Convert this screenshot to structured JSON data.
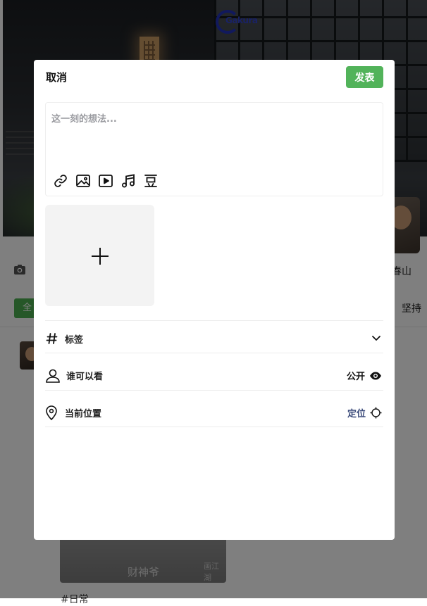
{
  "background": {
    "logo": {
      "name": "logo-icon",
      "text": "Gakura"
    },
    "profile_name": "春山",
    "tabs": {
      "first": "全",
      "last": "坚持"
    },
    "post": {
      "image_caption": "财神爷",
      "image_watermark": "画江湖",
      "tag": "#日常"
    },
    "overlay_color": "rgba(0,0,0,0.5)"
  },
  "modal": {
    "cancel_label": "取消",
    "publish_label": "发表",
    "publish_color": "#52b35a",
    "editor": {
      "placeholder": "这一刻的想法...",
      "value": "",
      "toolbar": [
        "link-icon",
        "image-icon",
        "video-icon",
        "music-icon",
        "douban-icon"
      ]
    },
    "upload": {
      "icon": "plus-icon"
    },
    "tags_row": {
      "icon": "hash-icon",
      "label": "标签",
      "action_icon": "chevron-down-icon"
    },
    "visibility_row": {
      "icon": "user-icon",
      "label": "谁可以看",
      "value": "公开",
      "value_icon": "eye-icon"
    },
    "location_row": {
      "icon": "location-pin-icon",
      "label": "当前位置",
      "value": "定位",
      "value_color": "#3a4a7a",
      "value_icon": "crosshair-icon"
    }
  }
}
